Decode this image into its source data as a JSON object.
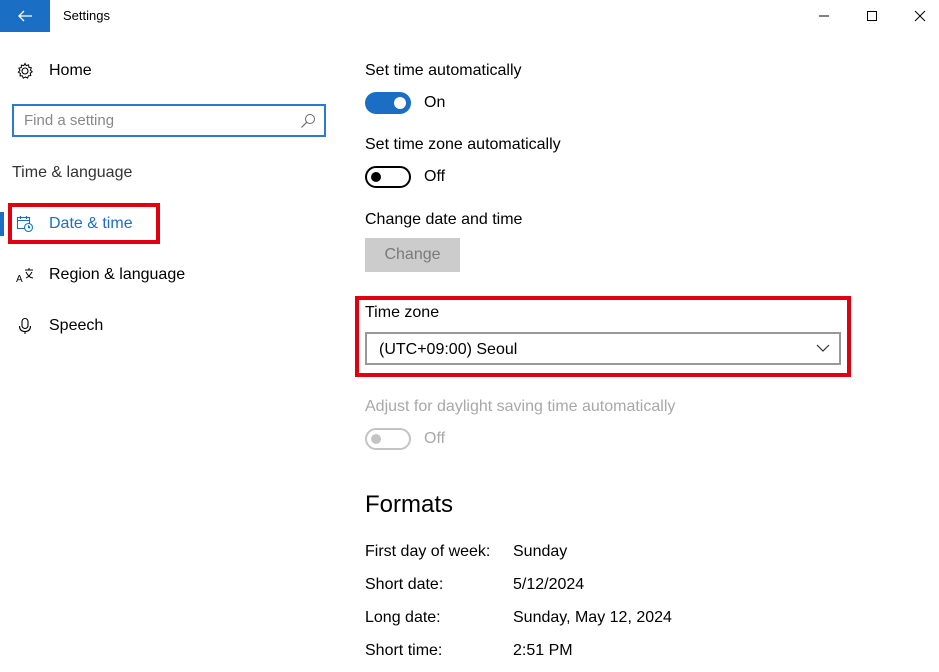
{
  "window": {
    "title": "Settings"
  },
  "sidebar": {
    "home_label": "Home",
    "search_placeholder": "Find a setting",
    "section_label": "Time & language",
    "items": [
      {
        "label": "Date & time",
        "icon": "calendar-clock-icon",
        "active": true
      },
      {
        "label": "Region & language",
        "icon": "region-language-icon",
        "active": false
      },
      {
        "label": "Speech",
        "icon": "microphone-icon",
        "active": false
      }
    ]
  },
  "main": {
    "set_time_auto": {
      "label": "Set time automatically",
      "state": "On"
    },
    "set_timezone_auto": {
      "label": "Set time zone automatically",
      "state": "Off"
    },
    "change_date_time": {
      "label": "Change date and time",
      "button": "Change"
    },
    "time_zone": {
      "label": "Time zone",
      "value": "(UTC+09:00) Seoul"
    },
    "daylight": {
      "label": "Adjust for daylight saving time automatically",
      "state": "Off"
    },
    "formats": {
      "title": "Formats",
      "rows": [
        {
          "key": "First day of week:",
          "value": "Sunday"
        },
        {
          "key": "Short date:",
          "value": "5/12/2024"
        },
        {
          "key": "Long date:",
          "value": "Sunday, May 12, 2024"
        },
        {
          "key": "Short time:",
          "value": "2:51 PM"
        }
      ]
    }
  },
  "colors": {
    "accent": "#1a6fc4",
    "highlight": "#e0000f"
  }
}
